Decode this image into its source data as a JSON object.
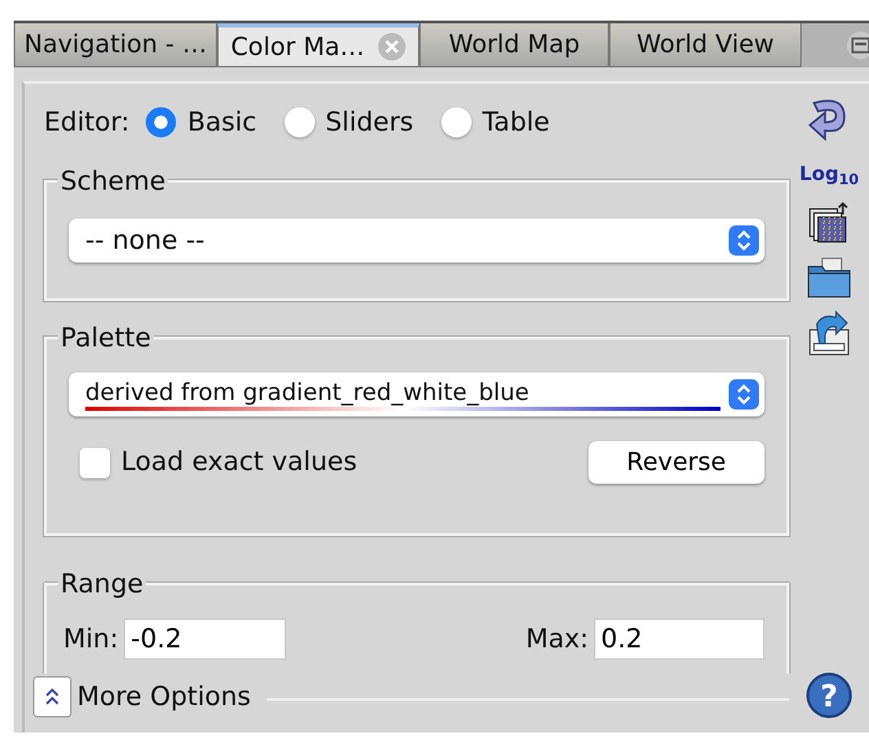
{
  "tabs": [
    {
      "label": "Navigation - …",
      "selected": false,
      "closable": false
    },
    {
      "label": "Color Ma…",
      "selected": true,
      "closable": true
    },
    {
      "label": "World Map",
      "selected": false,
      "closable": false
    },
    {
      "label": "World View",
      "selected": false,
      "closable": false
    }
  ],
  "editor": {
    "label": "Editor:",
    "options": [
      {
        "label": "Basic",
        "selected": true
      },
      {
        "label": "Sliders",
        "selected": false
      },
      {
        "label": "Table",
        "selected": false
      }
    ]
  },
  "scheme": {
    "title": "Scheme",
    "value": "-- none --"
  },
  "palette": {
    "title": "Palette",
    "value": "derived from gradient_red_white_blue",
    "load_exact": {
      "label": "Load exact values",
      "checked": false
    },
    "reverse": "Reverse"
  },
  "range": {
    "title": "Range",
    "min_label": "Min:",
    "min": "-0.2",
    "max_label": "Max:",
    "max": "0.2"
  },
  "side_tools": {
    "log_label": "Log$_{10}$",
    "help": "?"
  },
  "more_options": {
    "label": "More Options",
    "expanded": false
  }
}
